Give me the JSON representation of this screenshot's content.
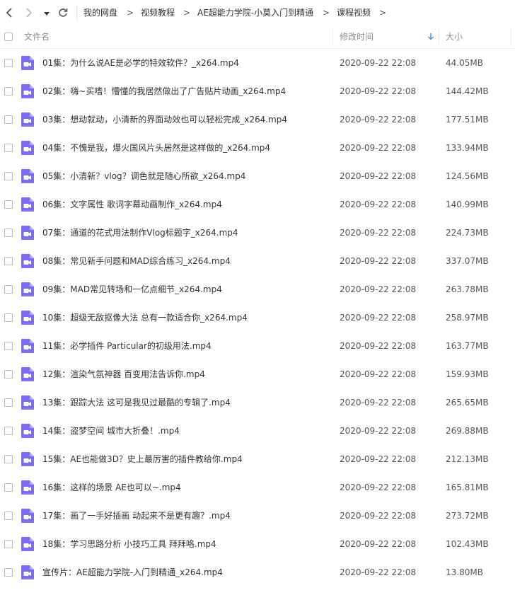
{
  "nav": {
    "back_icon": "chevron-left-icon",
    "forward_icon": "chevron-right-icon",
    "dropdown_icon": "caret-down-icon",
    "refresh_icon": "refresh-icon"
  },
  "breadcrumb": [
    "我的网盘",
    "视频教程",
    "AE超能力学院-小莫入门到精通",
    "课程视频"
  ],
  "breadcrumb_separator": ">",
  "columns": {
    "name": "文件名",
    "modified": "修改时间",
    "size": "大小",
    "sort_icon": "sort-down-arrow-icon",
    "sort_color": "#4a90e2"
  },
  "file_icon": {
    "name": "video-file-icon",
    "color": "#7b6cf0"
  },
  "files": [
    {
      "name": "01集：为什么说AE是必学的特效软件？_x264.mp4",
      "modified": "2020-09-22 22:08",
      "size": "44.05MB"
    },
    {
      "name": "02集：嗨~买嗜！懵懂的我居然做出了广告贴片动画_x264.mp4",
      "modified": "2020-09-22 22:08",
      "size": "144.42MB"
    },
    {
      "name": "03集：想动就动，小清新的界面动效也可以轻松完成_x264.mp4",
      "modified": "2020-09-22 22:08",
      "size": "177.51MB"
    },
    {
      "name": "04集：不愧是我，爆火国风片头居然是这样做的_x264.mp4",
      "modified": "2020-09-22 22:08",
      "size": "133.94MB"
    },
    {
      "name": "05集：小清新？vlog？调色就是随心所欲_x264.mp4",
      "modified": "2020-09-22 22:08",
      "size": "124.56MB"
    },
    {
      "name": "06集：文字属性 歌词字幕动画制作_x264.mp4",
      "modified": "2020-09-22 22:08",
      "size": "140.99MB"
    },
    {
      "name": "07集：通道的花式用法制作Vlog标题字_x264.mp4",
      "modified": "2020-09-22 22:08",
      "size": "224.73MB"
    },
    {
      "name": "08集：常见新手问题和MAD综合练习_x264.mp4",
      "modified": "2020-09-22 22:08",
      "size": "337.07MB"
    },
    {
      "name": "09集：MAD常见转场和一亿点细节_x264.mp4",
      "modified": "2020-09-22 22:08",
      "size": "263.78MB"
    },
    {
      "name": "10集：超级无敌抠像大法 总有一款适合你_x264.mp4",
      "modified": "2020-09-22 22:08",
      "size": "258.97MB"
    },
    {
      "name": "11集：必学插件 Particular的初级用法.mp4",
      "modified": "2020-09-22 22:08",
      "size": "163.77MB"
    },
    {
      "name": "12集：渲染气氛神器 百变用法告诉你.mp4",
      "modified": "2020-09-22 22:08",
      "size": "159.93MB"
    },
    {
      "name": "13集：跟踪大法 这可是我见过最酷的专辑了.mp4",
      "modified": "2020-09-22 22:08",
      "size": "265.65MB"
    },
    {
      "name": "14集：盗梦空间 城市大折叠！.mp4",
      "modified": "2020-09-22 22:08",
      "size": "269.88MB"
    },
    {
      "name": "15集：AE也能做3D？史上最厉害的插件教给你.mp4",
      "modified": "2020-09-22 22:08",
      "size": "212.13MB"
    },
    {
      "name": "16集：这样的场景 AE也可以~.mp4",
      "modified": "2020-09-22 22:08",
      "size": "165.81MB"
    },
    {
      "name": "17集：画了一手好插画 动起来不是更有趣？.mp4",
      "modified": "2020-09-22 22:08",
      "size": "273.72MB"
    },
    {
      "name": "18集：学习思路分析 小技巧工具 拜拜咯.mp4",
      "modified": "2020-09-22 22:08",
      "size": "102.43MB"
    },
    {
      "name": "宣传片：AE超能力学院-入门到精通_x264.mp4",
      "modified": "2020-09-22 22:08",
      "size": "13.80MB"
    }
  ]
}
